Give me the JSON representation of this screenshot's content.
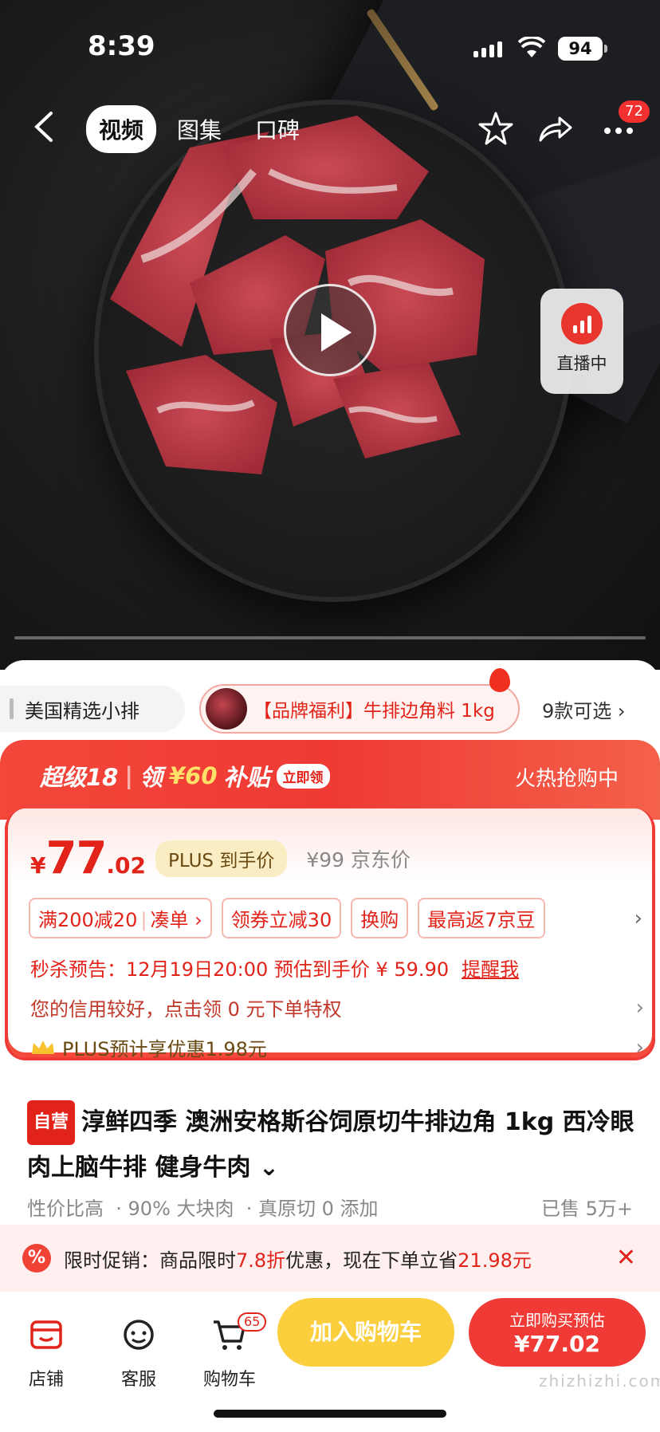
{
  "status_bar": {
    "time": "8:39",
    "battery": "94"
  },
  "top_nav": {
    "tabs": [
      {
        "label": "视频"
      },
      {
        "label": "图集"
      },
      {
        "label": "口碑"
      }
    ],
    "more_badge": "72"
  },
  "media": {
    "live_label": "直播中"
  },
  "variants": {
    "item1": "美国精选小排",
    "item2": "【品牌福利】牛排边角料 1kg",
    "more": "9款可选"
  },
  "promo": {
    "banner_prefix": "超级18",
    "banner_mid": "领",
    "banner_amount": "¥60",
    "banner_suffix": "补贴",
    "banner_chip": "立即领",
    "banner_right": "火热抢购中",
    "price_symbol": "¥",
    "price_int": "77",
    "price_dec": ".02",
    "plus_tag": "PLUS 到手价",
    "orig_price": "¥99 京东价",
    "coupons": [
      {
        "label": "满200减20"
      },
      {
        "label": "凑单 ›"
      },
      {
        "label": "领券立减30"
      },
      {
        "label": "换购"
      },
      {
        "label": "最高返7京豆"
      }
    ],
    "seckill_text": "秒杀预告：12月19日20:00 预估到手价 ¥ 59.90",
    "seckill_link": "提醒我",
    "credit_text": "您的信用较好，点击领 0 元下单特权",
    "plus_text": "PLUS预计享优惠1.98元"
  },
  "product": {
    "self_tag": "自营",
    "title": "淳鲜四季 澳洲安格斯谷饲原切牛排边角 1kg 西冷眼肉上脑牛排 健身牛肉 ⌄",
    "tags": [
      "性价比高",
      "· 90% 大块肉",
      "· 真原切 0 添加"
    ],
    "sold": "已售 5万+"
  },
  "limited": {
    "prefix": "限时促销：商品限时",
    "discount": "7.8折",
    "mid": "优惠，现在下单立省",
    "saving": "21.98元"
  },
  "bottom_bar": {
    "shop": "店铺",
    "service": "客服",
    "cart": "购物车",
    "cart_badge": "65",
    "add_cart": "加入购物车",
    "buy_line1": "立即购买预估",
    "buy_line2": "¥77.02"
  },
  "watermark": "zhizhizhi.com",
  "colors": {
    "accent": "#e2231a",
    "yellow": "#fbce3d",
    "plus_gold": "#fbedc3"
  }
}
